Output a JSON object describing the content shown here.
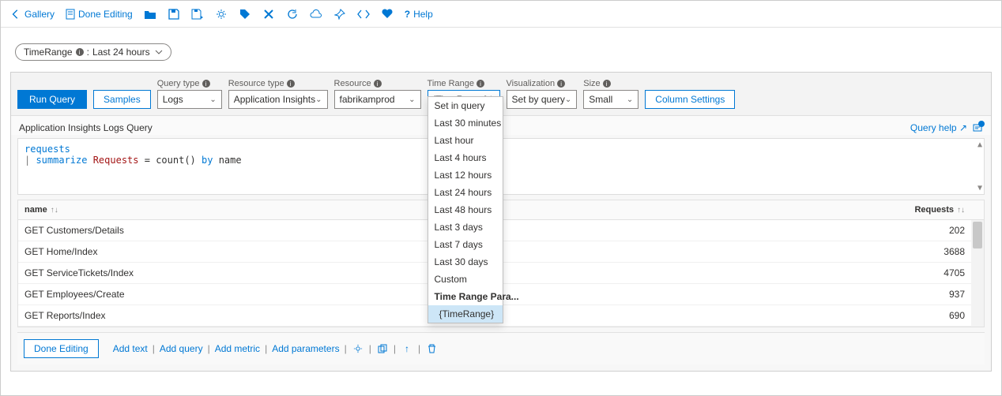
{
  "toolbar": {
    "gallery": "Gallery",
    "done_editing": "Done Editing",
    "help": "Help"
  },
  "pill": {
    "param": "TimeRange",
    "sep": " : ",
    "value": "Last 24 hours"
  },
  "edit_button": "↑ Edit",
  "query": {
    "run": "Run Query",
    "samples": "Samples",
    "labels": {
      "query_type": "Query type",
      "resource_type": "Resource type",
      "resource": "Resource",
      "time_range": "Time Range",
      "visualization": "Visualization",
      "size": "Size"
    },
    "values": {
      "query_type": "Logs",
      "resource_type": "Application Insights",
      "resource": "fabrikamprod",
      "time_range": "{TimeRange}",
      "visualization": "Set by query",
      "size": "Small"
    },
    "column_settings": "Column Settings",
    "section_title": "Application Insights Logs Query",
    "query_help": "Query help",
    "code": {
      "l1_requests": "requests",
      "l2_pipe": "| ",
      "l2_summarize": "summarize",
      "l2_requests": " Requests",
      "l2_eq": " = ",
      "l2_count": "count()",
      "l2_by": " by ",
      "l2_name": "name"
    }
  },
  "time_range_menu": [
    {
      "label": "Set in query"
    },
    {
      "label": "Last 30 minutes"
    },
    {
      "label": "Last hour"
    },
    {
      "label": "Last 4 hours"
    },
    {
      "label": "Last 12 hours"
    },
    {
      "label": "Last 24 hours"
    },
    {
      "label": "Last 48 hours"
    },
    {
      "label": "Last 3 days"
    },
    {
      "label": "Last 7 days"
    },
    {
      "label": "Last 30 days"
    },
    {
      "label": "Custom"
    },
    {
      "label": "Time Range Para...",
      "bold": true
    },
    {
      "label": "{TimeRange}",
      "selected": true
    }
  ],
  "grid": {
    "columns": {
      "name": "name",
      "requests": "Requests"
    },
    "rows": [
      {
        "name": "GET Customers/Details",
        "requests": 202
      },
      {
        "name": "GET Home/Index",
        "requests": 3688
      },
      {
        "name": "GET ServiceTickets/Index",
        "requests": 4705
      },
      {
        "name": "GET Employees/Create",
        "requests": 937
      },
      {
        "name": "GET Reports/Index",
        "requests": 690
      }
    ]
  },
  "footer": {
    "done_editing": "Done Editing",
    "add_text": "Add text",
    "add_query": "Add query",
    "add_metric": "Add metric",
    "add_parameters": "Add parameters"
  }
}
